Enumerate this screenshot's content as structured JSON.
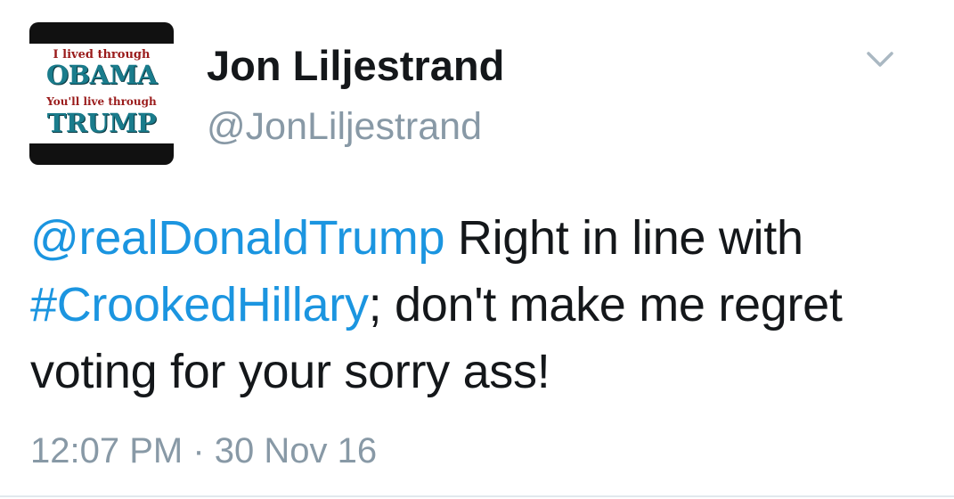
{
  "avatar": {
    "line1": "I lived through",
    "line2": "OBAMA",
    "line3": "You'll live through",
    "line4": "TRUMP"
  },
  "user": {
    "display_name": "Jon Liljestrand",
    "handle": "@JonLiljestrand"
  },
  "menu": {
    "icon": "chevron-down-icon"
  },
  "tweet": {
    "mention": "@realDonaldTrump",
    "text_part1": " Right in line with ",
    "hashtag": "#CrookedHillary",
    "text_part2": "; don't make me regret voting for your sorry ass!",
    "timestamp": "12:07 PM · 30 Nov 16"
  },
  "colors": {
    "link": "#1b95e0",
    "text": "#14171a",
    "muted": "#8899a6"
  }
}
